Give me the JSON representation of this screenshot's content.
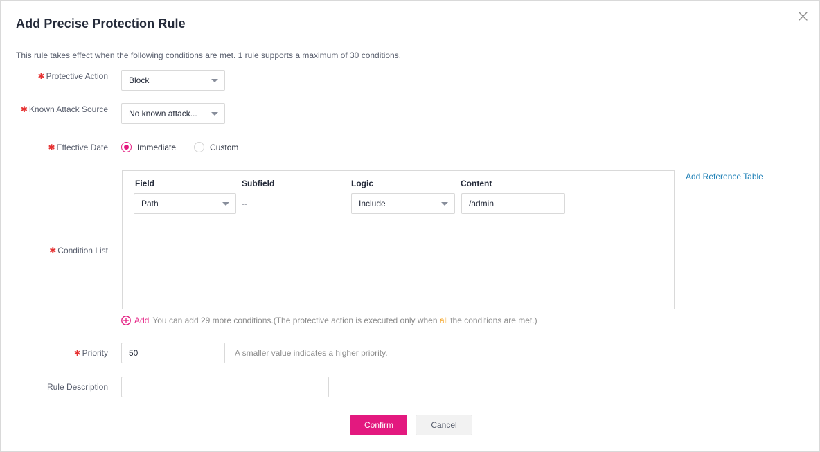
{
  "dialog": {
    "title": "Add Precise Protection Rule",
    "subtitle": "This rule takes effect when the following conditions are met. 1 rule supports a maximum of 30 conditions.",
    "close_icon": "close-icon"
  },
  "colors": {
    "accent": "#e3197f",
    "link": "#1b7eb5",
    "required": "#e63232",
    "highlight": "#f39c12",
    "border": "#d9d9d9",
    "text": "#252b3a",
    "muted": "#8c8c8c"
  },
  "fields": {
    "protective_action": {
      "label": "Protective Action",
      "required": true,
      "value": "Block"
    },
    "known_attack_source": {
      "label": "Known Attack Source",
      "required": true,
      "value": "No known attack..."
    },
    "effective_date": {
      "label": "Effective Date",
      "required": true,
      "options": [
        {
          "label": "Immediate",
          "selected": true
        },
        {
          "label": "Custom",
          "selected": false
        }
      ]
    },
    "condition_list": {
      "label": "Condition List",
      "required": true,
      "columns": [
        "Field",
        "Subfield",
        "Logic",
        "Content"
      ],
      "rows": [
        {
          "field": "Path",
          "subfield": "--",
          "logic": "Include",
          "content": "/admin"
        }
      ],
      "reference_link": "Add Reference Table",
      "add_label": "Add",
      "add_hint_before": "You can add 29 more conditions.(The protective action is executed only when ",
      "add_hint_highlight": "all",
      "add_hint_after": " the conditions are met.)"
    },
    "priority": {
      "label": "Priority",
      "required": true,
      "value": "50",
      "hint": "A smaller value indicates a higher priority."
    },
    "rule_description": {
      "label": "Rule Description",
      "required": false,
      "value": "",
      "placeholder": ""
    }
  },
  "footer": {
    "confirm_label": "Confirm",
    "cancel_label": "Cancel"
  }
}
